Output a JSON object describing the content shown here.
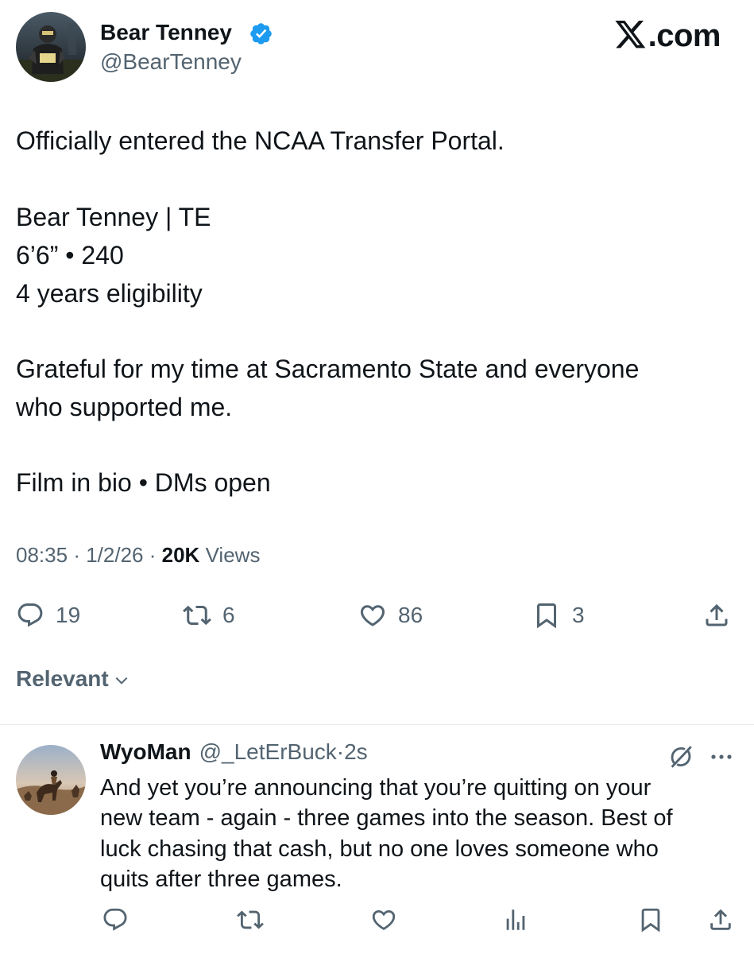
{
  "header": {
    "brand": "X.com"
  },
  "tweet": {
    "author_name": "Bear Tenney",
    "author_handle": "@BearTenney",
    "verified": true,
    "lines": [
      "Officially entered the NCAA Transfer Portal.",
      "Bear Tenney | TE",
      "6’6” • 240",
      "4 years eligibility",
      "Grateful for my time at Sacramento State and everyone",
      "who supported me.",
      "Film in bio • DMs open"
    ],
    "time": "08:35",
    "date": "1/2/26",
    "views_count": "20K",
    "views_label": "Views",
    "meta_sep": "·",
    "stats": {
      "replies": "19",
      "reposts": "6",
      "likes": "86",
      "bookmarks": "3"
    }
  },
  "sort": {
    "label": "Relevant"
  },
  "reply": {
    "author_name": "WyoMan",
    "author_handle": "@_LetErBuck",
    "age": "·2s",
    "lines": [
      "And yet you’re announcing that you’re quitting on your",
      "new team - again - three games into the season. Best of",
      "luck chasing that cash, but no one loves someone who",
      "quits after three games."
    ]
  },
  "icons": {
    "reply": "speech-bubble-icon",
    "repost": "repost-arrows-icon",
    "like": "heart-icon",
    "bookmark": "bookmark-icon",
    "share": "share-icon",
    "views": "bar-chart-icon",
    "grok": "grok-icon",
    "more": "more-dots-icon"
  },
  "colors": {
    "text": "#0f1419",
    "secondary": "#536471",
    "verified": "#1d9bf0",
    "divider": "#e7e9ea"
  }
}
